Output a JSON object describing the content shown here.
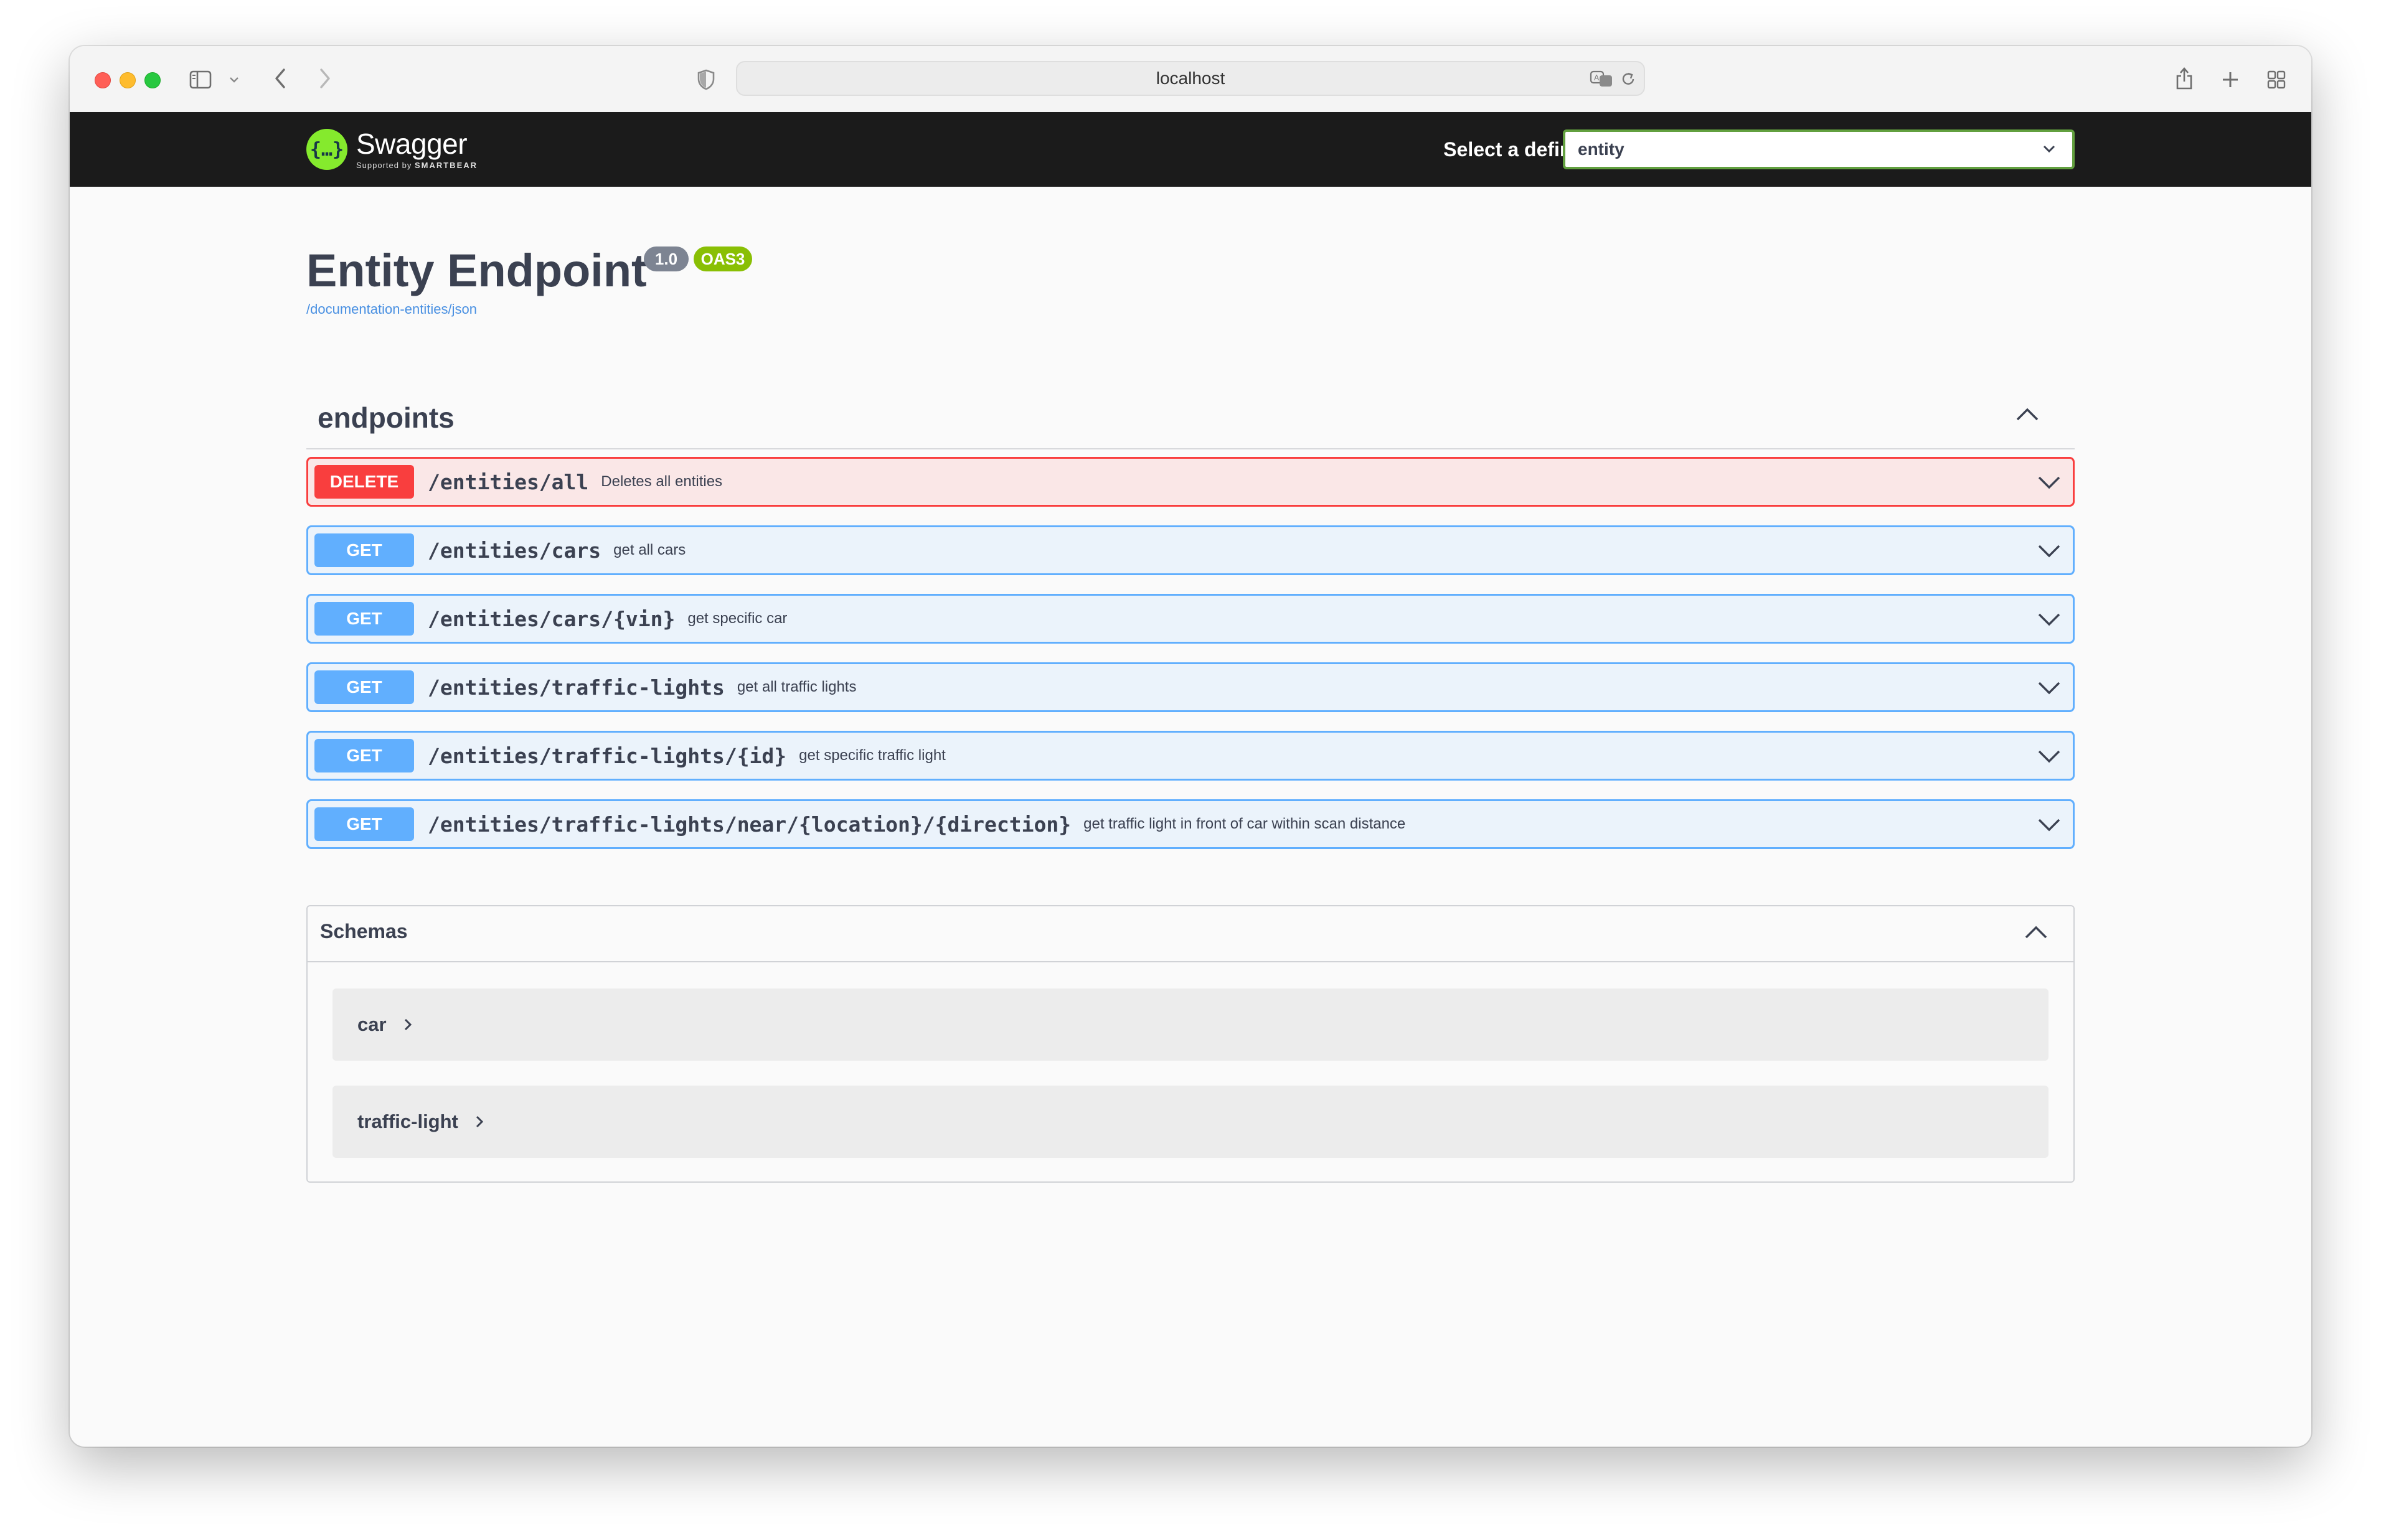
{
  "browser": {
    "address": "localhost"
  },
  "topbar": {
    "logo_title": "Swagger",
    "logo_supported": "Supported by",
    "logo_brand": "SMARTBEAR",
    "definition_label": "Select a definition",
    "definition_value": "entity"
  },
  "info": {
    "title": "Entity Endpoint",
    "version": "1.0",
    "oas": "OAS3",
    "url": "/documentation-entities/json"
  },
  "tag": {
    "name": "endpoints"
  },
  "operations": [
    {
      "method": "DELETE",
      "path": "/entities/all",
      "summary": "Deletes all entities"
    },
    {
      "method": "GET",
      "path": "/entities/cars",
      "summary": "get all cars"
    },
    {
      "method": "GET",
      "path": "/entities/cars/{vin}",
      "summary": "get specific car"
    },
    {
      "method": "GET",
      "path": "/entities/traffic-lights",
      "summary": "get all traffic lights"
    },
    {
      "method": "GET",
      "path": "/entities/traffic-lights/{id}",
      "summary": "get specific traffic light"
    },
    {
      "method": "GET",
      "path": "/entities/traffic-lights/near/{location}/{direction}",
      "summary": "get traffic light in front of car within scan distance"
    }
  ],
  "schemas": {
    "title": "Schemas",
    "models": [
      {
        "name": "car"
      },
      {
        "name": "traffic-light"
      }
    ]
  },
  "colors": {
    "delete": "#f93e3e",
    "get": "#61affe",
    "topbar": "#1b1b1b",
    "swagger_green": "#85ea2d",
    "oas_badge": "#89bf04"
  }
}
